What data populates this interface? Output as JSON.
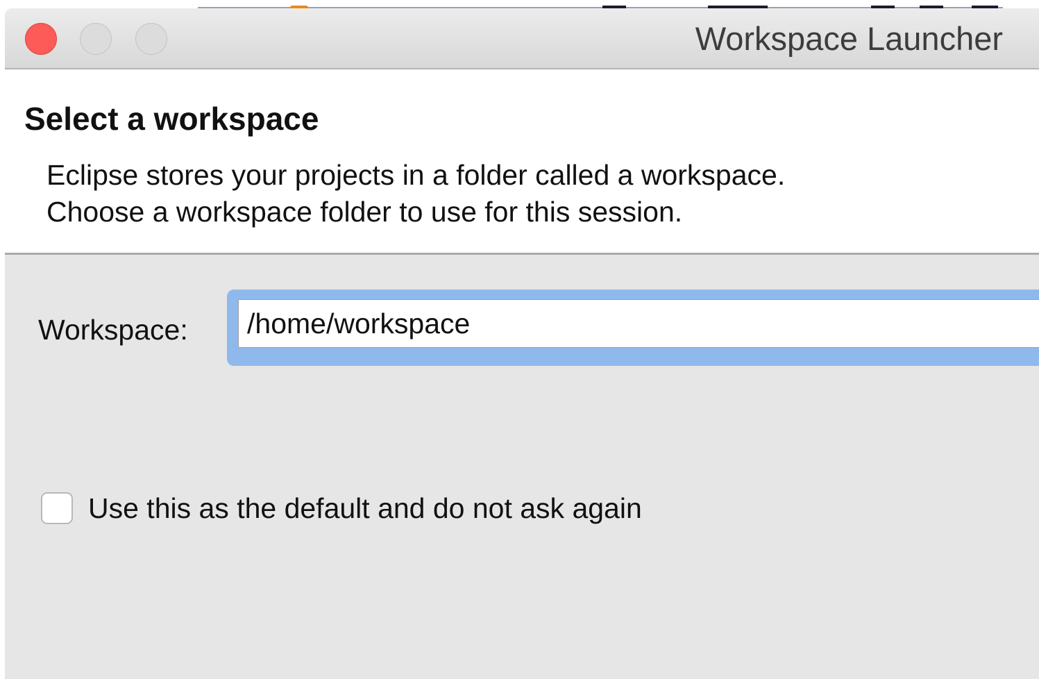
{
  "window": {
    "title": "Workspace Launcher"
  },
  "header": {
    "title": "Select a workspace",
    "description_lines": [
      "Eclipse stores your projects in a folder called a workspace.",
      "Choose a workspace folder to use for this session."
    ]
  },
  "form": {
    "workspace_label": "Workspace:",
    "workspace_value": "/home/workspace",
    "default_checkbox_label": "Use this as the default and do not ask again",
    "default_checked": false
  },
  "colors": {
    "close_button": "#fc5b57",
    "focus_ring": "#8fb9ec",
    "dialog_background": "#e6e6e6"
  }
}
